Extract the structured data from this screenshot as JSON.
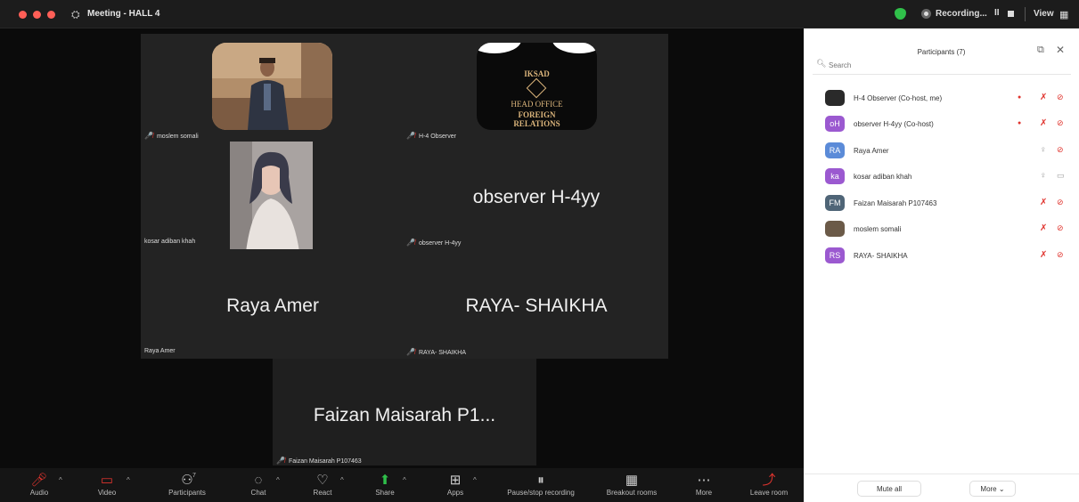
{
  "window": {
    "title": "Meeting - HALL 4",
    "recording_label": "Recording...",
    "view_label": "View"
  },
  "tiles": [
    {
      "name": "moslem somali",
      "muted": true
    },
    {
      "name": "H-4 Observer",
      "muted": true
    },
    {
      "name": "kosar adiban khah",
      "muted": false
    },
    {
      "name": "observer H-4yy",
      "big_name": "observer H-4yy",
      "muted": true
    },
    {
      "name": "Raya Amer",
      "big_name": "Raya Amer",
      "muted": false
    },
    {
      "name": "RAYA- SHAIKHA",
      "big_name": "RAYA- SHAIKHA",
      "muted": true
    },
    {
      "name": "Faizan Maisarah P107463",
      "big_name": "Faizan Maisarah P1...",
      "muted": true
    }
  ],
  "iksad_logo": {
    "line1": "IKSAD",
    "line2": "HEAD OFFICE",
    "line3": "FOREIGN",
    "line4": "RELATIONS"
  },
  "panel": {
    "title": "Participants (7)",
    "search_placeholder": "Search",
    "participants": [
      {
        "initials": "",
        "name": "H-4 Observer (Co-host, me)",
        "avatar_color": "#2a2a2a",
        "hand_dot": true,
        "mic": "muted",
        "cam": "off"
      },
      {
        "initials": "oH",
        "name": "observer H-4yy (Co-host)",
        "avatar_color": "#9b59d0",
        "hand_dot": true,
        "mic": "muted",
        "cam": "off"
      },
      {
        "initials": "RA",
        "name": "Raya Amer",
        "avatar_color": "#5b8bd8",
        "hand_dot": false,
        "mic": "on",
        "cam": "off"
      },
      {
        "initials": "ka",
        "name": "kosar adiban khah",
        "avatar_color": "#9b59d0",
        "hand_dot": false,
        "mic": "on",
        "cam": "on"
      },
      {
        "initials": "FM",
        "name": "Faizan Maisarah P107463",
        "avatar_color": "#4f6577",
        "hand_dot": false,
        "mic": "muted",
        "cam": "off"
      },
      {
        "initials": "",
        "name": "moslem somali",
        "avatar_color": "#6b5a48",
        "hand_dot": false,
        "mic": "muted",
        "cam": "off"
      },
      {
        "initials": "RS",
        "name": "RAYA- SHAIKHA",
        "avatar_color": "#9b59d0",
        "hand_dot": false,
        "mic": "muted",
        "cam": "off"
      }
    ],
    "mute_all": "Mute all",
    "more": "More"
  },
  "toolbar": {
    "items": [
      {
        "label": "Audio",
        "icon": "mic-muted-icon"
      },
      {
        "label": "Video",
        "icon": "video-off-icon"
      },
      {
        "label": "Participants",
        "icon": "participants-icon",
        "count": "7"
      },
      {
        "label": "Chat",
        "icon": "chat-icon"
      },
      {
        "label": "React",
        "icon": "react-icon"
      },
      {
        "label": "Share",
        "icon": "share-icon"
      },
      {
        "label": "Apps",
        "icon": "apps-icon"
      },
      {
        "label": "Pause/stop recording",
        "icon": "pause-stop-icon"
      },
      {
        "label": "Breakout rooms",
        "icon": "breakout-icon"
      },
      {
        "label": "More",
        "icon": "more-icon"
      },
      {
        "label": "Leave room",
        "icon": "leave-icon"
      }
    ]
  },
  "colors": {
    "accent_green": "#2fbf4a",
    "muted_red": "#e0342e",
    "panel_bg": "#ffffff",
    "meeting_bg": "#0b0b0b",
    "tile_bg": "#232323"
  }
}
